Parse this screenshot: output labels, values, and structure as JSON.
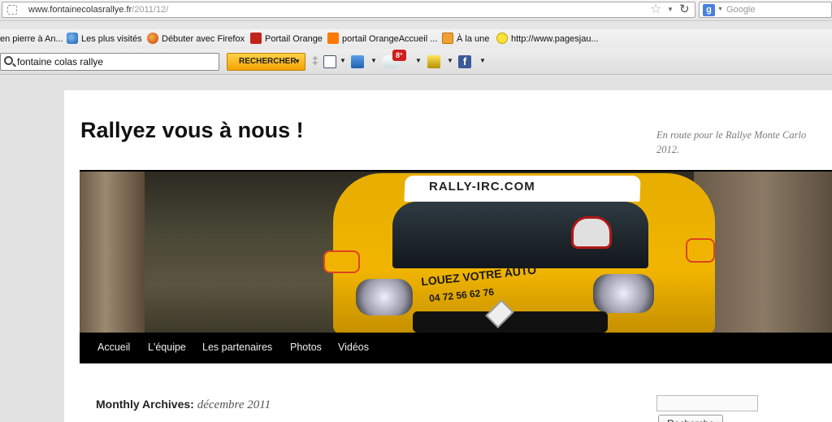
{
  "browser": {
    "url_host": "www.fontainecolasrallye.fr",
    "url_path": "/2011/12/",
    "search_engine_placeholder": "Google",
    "search_engine_logo": "g"
  },
  "bookmarks": [
    {
      "label": "en pierre à An...",
      "icon": "none"
    },
    {
      "label": "Les plus visités",
      "icon": "globe-icon"
    },
    {
      "label": "Débuter avec Firefox",
      "icon": "firefox-icon"
    },
    {
      "label": "Portail Orange",
      "icon": "wifi-icon"
    },
    {
      "label": "portail OrangeAccueil ...",
      "icon": "orange-icon"
    },
    {
      "label": "À la une",
      "icon": "rss-icon"
    },
    {
      "label": "http://www.pagesjau...",
      "icon": "smile-icon"
    }
  ],
  "toolbar": {
    "search_value": "fontaine colas rallye",
    "search_button": "RECHERCHER",
    "weather_badge": "8°",
    "facebook_letter": "f"
  },
  "site": {
    "title": "Rallyez vous à nous !",
    "description": "En route pour le Rallye Monte Carlo 2012.",
    "header_roof_text": "RALLY-IRC.COM",
    "car_ad_line1": "LOUEZ VOTRE AUTO",
    "car_ad_line2": "04 72 56 62 76"
  },
  "nav": [
    {
      "label": "Accueil"
    },
    {
      "label": "L'équipe"
    },
    {
      "label": "Les partenaires"
    },
    {
      "label": "Photos"
    },
    {
      "label": "Vidéos"
    }
  ],
  "archive": {
    "prefix": "Monthly Archives:",
    "date": "décembre 2011"
  },
  "sidebar": {
    "search_button": "Recherche"
  }
}
